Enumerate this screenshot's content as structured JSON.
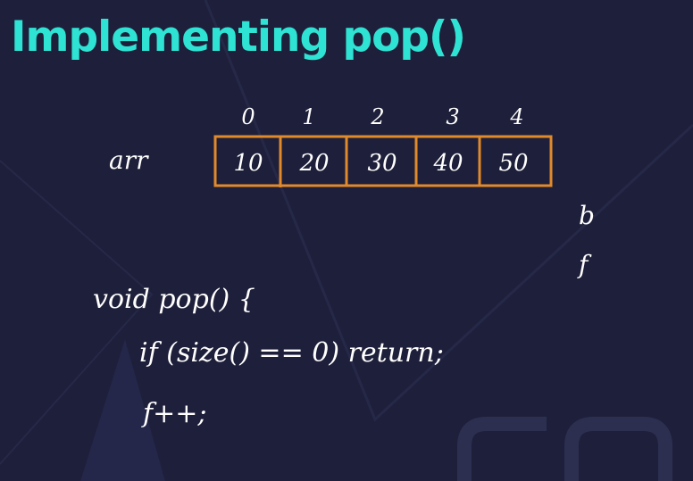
{
  "title": "Implementing pop()",
  "array": {
    "label": "arr",
    "indices": [
      "0",
      "1",
      "2",
      "3",
      "4"
    ],
    "values": [
      "10",
      "20",
      "30",
      "40",
      "50"
    ]
  },
  "pointers": {
    "back": "b",
    "front": "f"
  },
  "code": {
    "line1": "void pop() {",
    "line2": "if (size() == 0) return;",
    "line3": "f++;"
  },
  "colors": {
    "background": "#1e1f3a",
    "title": "#2ee3d3",
    "array_border": "#e08a2c",
    "ink": "#ffffff"
  }
}
